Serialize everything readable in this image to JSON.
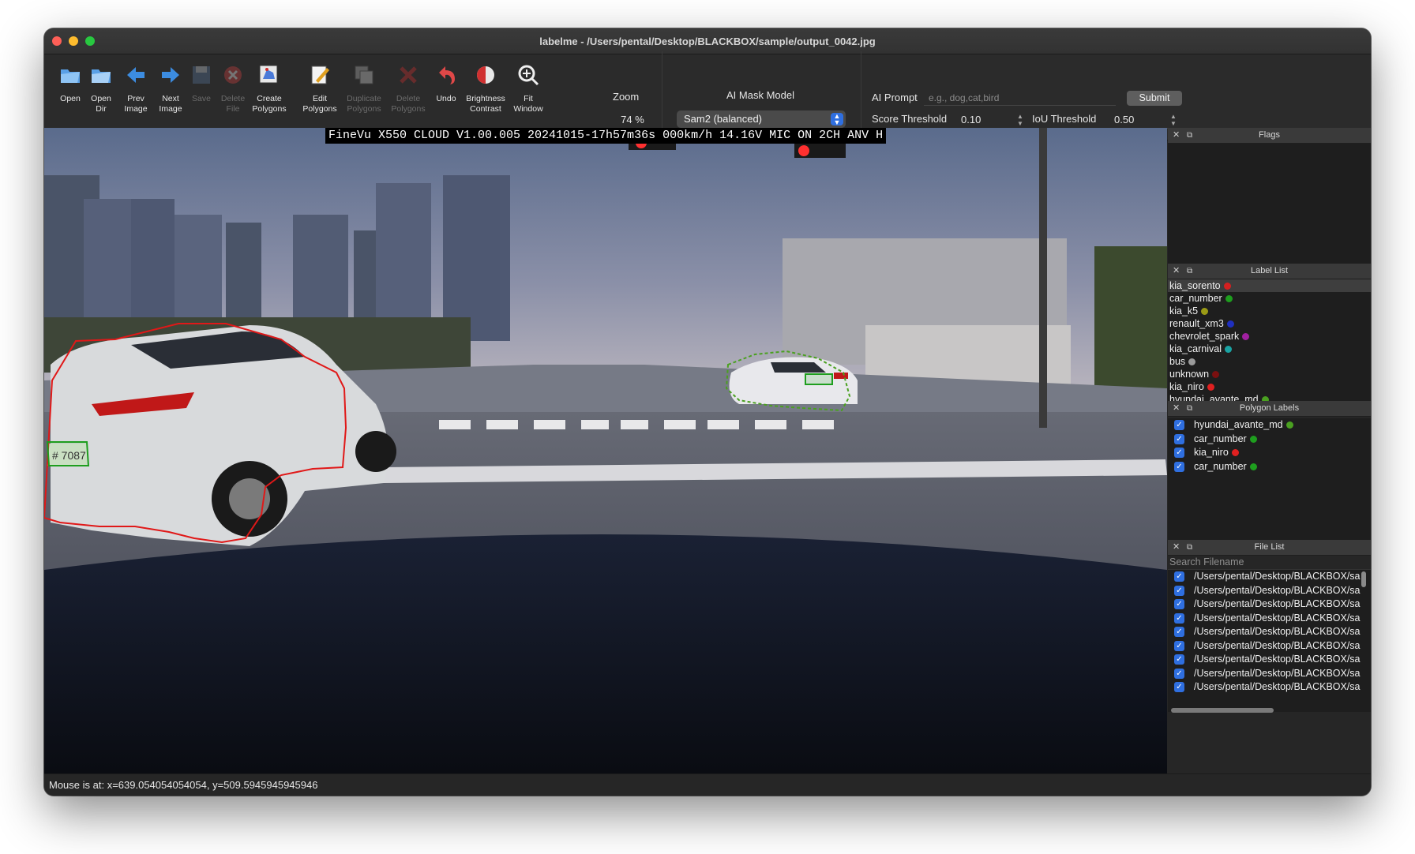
{
  "window": {
    "title": "labelme - /Users/pental/Desktop/BLACKBOX/sample/output_0042.jpg"
  },
  "toolbar": {
    "tools": [
      {
        "label": "Open",
        "icon": "open-folder-icon",
        "disabled": false
      },
      {
        "label": "Open\nDir",
        "icon": "open-dir-icon",
        "disabled": false
      },
      {
        "label": "Prev\nImage",
        "icon": "arrow-left-icon",
        "disabled": false
      },
      {
        "label": "Next\nImage",
        "icon": "arrow-right-icon",
        "disabled": false
      },
      {
        "label": "Save",
        "icon": "save-icon",
        "disabled": true
      },
      {
        "label": "Delete\nFile",
        "icon": "delete-file-icon",
        "disabled": true
      },
      {
        "label": "Create\nPolygons",
        "icon": "create-polygons-icon",
        "disabled": false
      },
      {
        "label": "Edit\nPolygons",
        "icon": "edit-polygons-icon",
        "disabled": false
      },
      {
        "label": "Duplicate\nPolygons",
        "icon": "duplicate-polygons-icon",
        "disabled": true
      },
      {
        "label": "Delete\nPolygons",
        "icon": "delete-polygons-icon",
        "disabled": true
      },
      {
        "label": "Undo",
        "icon": "undo-icon",
        "disabled": false
      },
      {
        "label": "Brightness\nContrast",
        "icon": "brightness-contrast-icon",
        "disabled": false
      },
      {
        "label": "Fit\nWindow",
        "icon": "fit-window-icon",
        "disabled": false
      }
    ],
    "zoom_title": "Zoom",
    "zoom_value": "74 %",
    "ai_mask_title": "AI Mask Model",
    "ai_mask_value": "Sam2 (balanced)",
    "ai_prompt_label": "AI Prompt",
    "ai_prompt_placeholder": "e.g., dog,cat,bird",
    "submit_label": "Submit",
    "score_threshold_label": "Score Threshold",
    "score_threshold_value": "0.10",
    "iou_threshold_label": "IoU Threshold",
    "iou_threshold_value": "0.50"
  },
  "canvas": {
    "osd_text": "FineVu X550 CLOUD V1.00.005 20241015-17h57m36s 000km/h 14.16V MIC  ON 2CH ANV H",
    "plate_text": "# 7087"
  },
  "docks": {
    "flags_title": "Flags",
    "label_list_title": "Label List",
    "polygon_labels_title": "Polygon Labels",
    "file_list_title": "File List",
    "search_placeholder": "Search Filename"
  },
  "label_list": [
    {
      "label": "kia_sorento",
      "color": "#d42020"
    },
    {
      "label": "car_number",
      "color": "#1e9e1e"
    },
    {
      "label": "kia_k5",
      "color": "#9a9a16"
    },
    {
      "label": "renault_xm3",
      "color": "#1f2fbf"
    },
    {
      "label": "chevrolet_spark",
      "color": "#a020a0"
    },
    {
      "label": "kia_carnival",
      "color": "#1aa3a3"
    },
    {
      "label": "bus",
      "color": "#9a9a9a"
    },
    {
      "label": "unknown",
      "color": "#7a1010"
    },
    {
      "label": "kia_niro",
      "color": "#e02020"
    },
    {
      "label": "hyundai_avante_md",
      "color": "#4aa020"
    }
  ],
  "polygon_labels": [
    {
      "label": "hyundai_avante_md",
      "color": "#4aa020"
    },
    {
      "label": "car_number",
      "color": "#1e9e1e"
    },
    {
      "label": "kia_niro",
      "color": "#e02020"
    },
    {
      "label": "car_number",
      "color": "#1e9e1e"
    }
  ],
  "file_list": [
    "/Users/pental/Desktop/BLACKBOX/sa",
    "/Users/pental/Desktop/BLACKBOX/sa",
    "/Users/pental/Desktop/BLACKBOX/sa",
    "/Users/pental/Desktop/BLACKBOX/sa",
    "/Users/pental/Desktop/BLACKBOX/sa",
    "/Users/pental/Desktop/BLACKBOX/sa",
    "/Users/pental/Desktop/BLACKBOX/sa",
    "/Users/pental/Desktop/BLACKBOX/sa",
    "/Users/pental/Desktop/BLACKBOX/sa"
  ],
  "status": {
    "text": "Mouse is at: x=639.054054054054, y=509.5945945945946"
  }
}
